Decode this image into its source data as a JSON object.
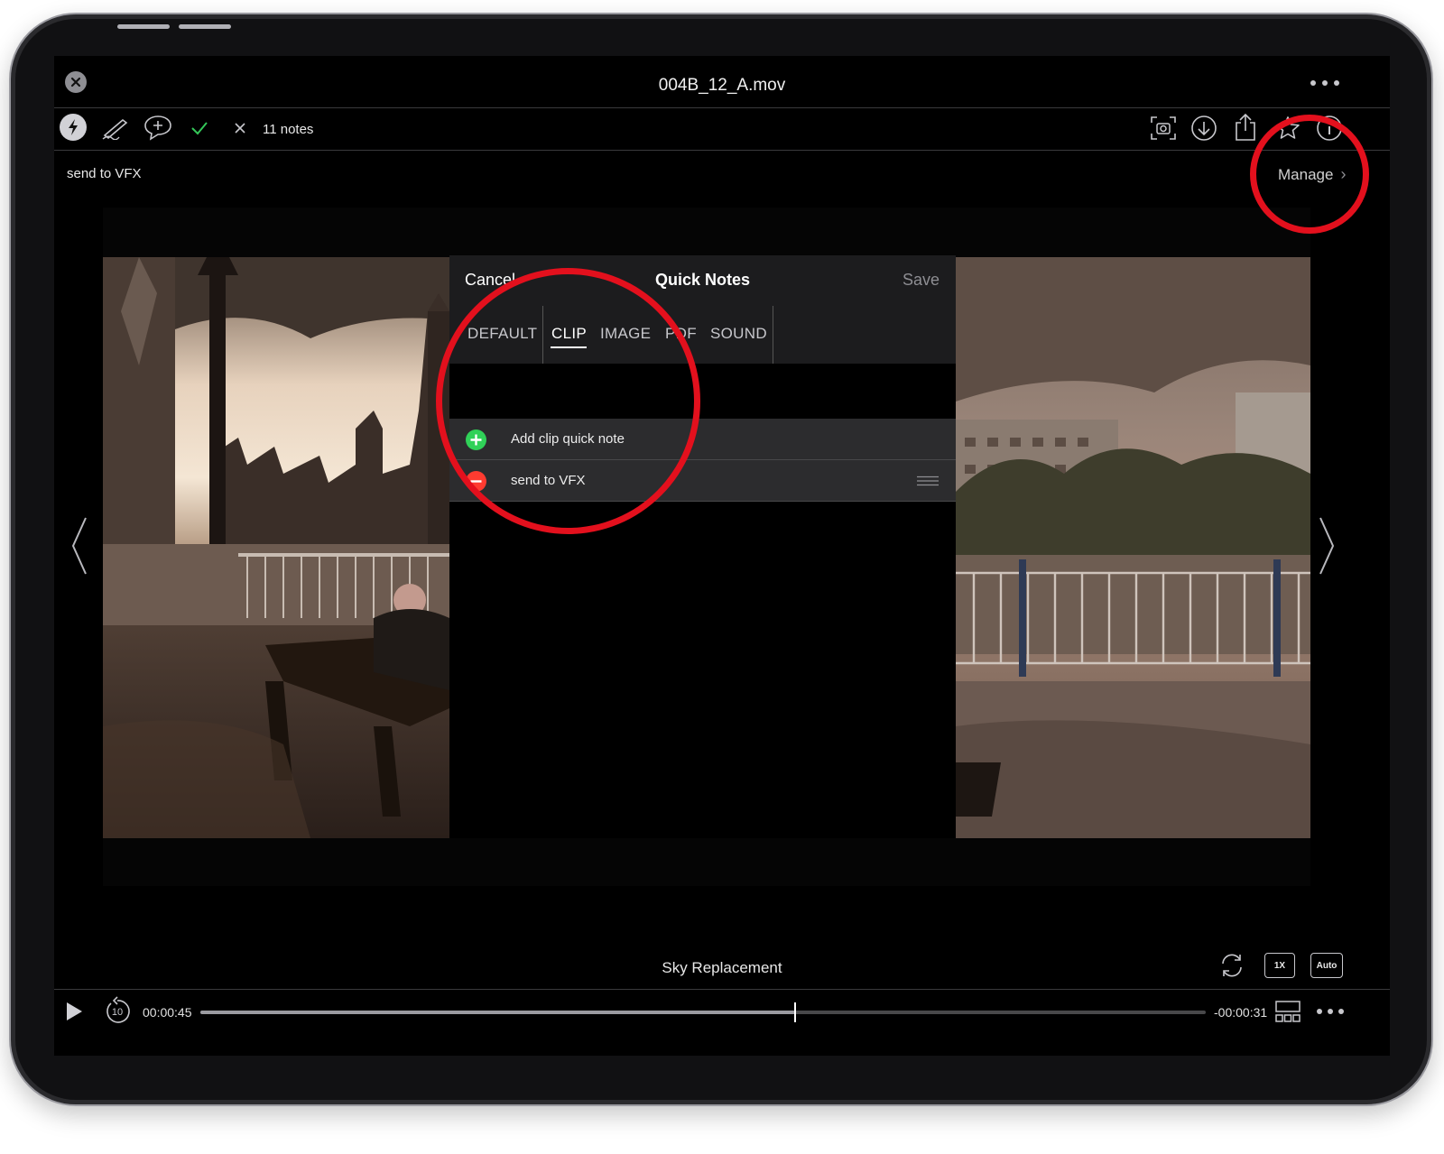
{
  "header": {
    "file_name": "004B_12_A.mov",
    "close_icon": "close-circle-icon",
    "more_icon": "ellipsis-icon"
  },
  "toolbar": {
    "left_icons": [
      "lightning-icon",
      "pen-icon",
      "add-comment-icon",
      "checkmark-icon",
      "x-icon"
    ],
    "notes_count": "11 notes",
    "right_icons": [
      "screenshot-icon",
      "download-icon",
      "share-icon",
      "star-icon",
      "info-icon"
    ]
  },
  "subheader": {
    "breadcrumb": "send to VFX",
    "manage_label": "Manage",
    "manage_chevron": "›"
  },
  "quick_notes": {
    "cancel_label": "Cancel",
    "title": "Quick Notes",
    "save_label": "Save",
    "tabs": [
      "DEFAULT",
      "CLIP",
      "IMAGE",
      "PDF",
      "SOUND"
    ],
    "active_tab": "CLIP",
    "add_row_label": "Add clip quick note",
    "notes": [
      {
        "label": "send to VFX"
      }
    ]
  },
  "player": {
    "clip_name": "Sky Replacement",
    "elapsed": "00:00:45",
    "remaining": "-00:00:31",
    "skip_label": "10",
    "speed_label": "1X",
    "quality_label": "Auto",
    "progress": 0.592
  },
  "colors": {
    "callout": "#e3101d",
    "add_green": "#30d158",
    "delete_red": "#ff3b30",
    "check_green": "#34c759"
  }
}
